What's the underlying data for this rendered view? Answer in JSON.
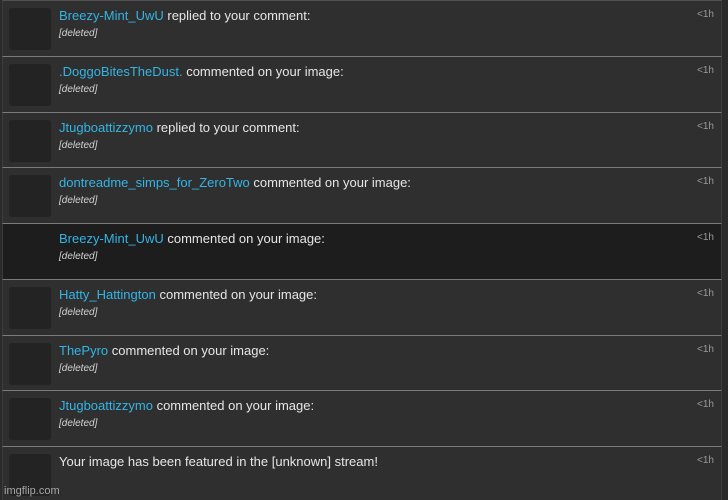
{
  "notifications": [
    {
      "user": "Breezy-Mint_UwU",
      "action": "replied to your comment:",
      "detail": "[deleted]",
      "time": "<1h"
    },
    {
      "user": ".DoggoBitesTheDust.",
      "action": "commented on your image:",
      "detail": "[deleted]",
      "time": "<1h"
    },
    {
      "user": "Jtugboattizzymo",
      "action": "replied to your comment:",
      "detail": "[deleted]",
      "time": "<1h"
    },
    {
      "user": "dontreadme_simps_for_ZeroTwo",
      "action": "commented on your image:",
      "detail": "[deleted]",
      "time": "<1h"
    },
    {
      "user": "Breezy-Mint_UwU",
      "action": "commented on your image:",
      "detail": "[deleted]",
      "time": "<1h"
    },
    {
      "user": "Hatty_Hattington",
      "action": "commented on your image:",
      "detail": "[deleted]",
      "time": "<1h"
    },
    {
      "user": "ThePyro",
      "action": "commented on your image:",
      "detail": "[deleted]",
      "time": "<1h"
    },
    {
      "user": "Jtugboattizzymo",
      "action": "commented on your image:",
      "detail": "[deleted]",
      "time": "<1h"
    },
    {
      "user": "",
      "action": "Your image has been featured in the [unknown] stream!",
      "detail": "",
      "time": "<1h"
    }
  ],
  "watermark": "imgflip.com"
}
